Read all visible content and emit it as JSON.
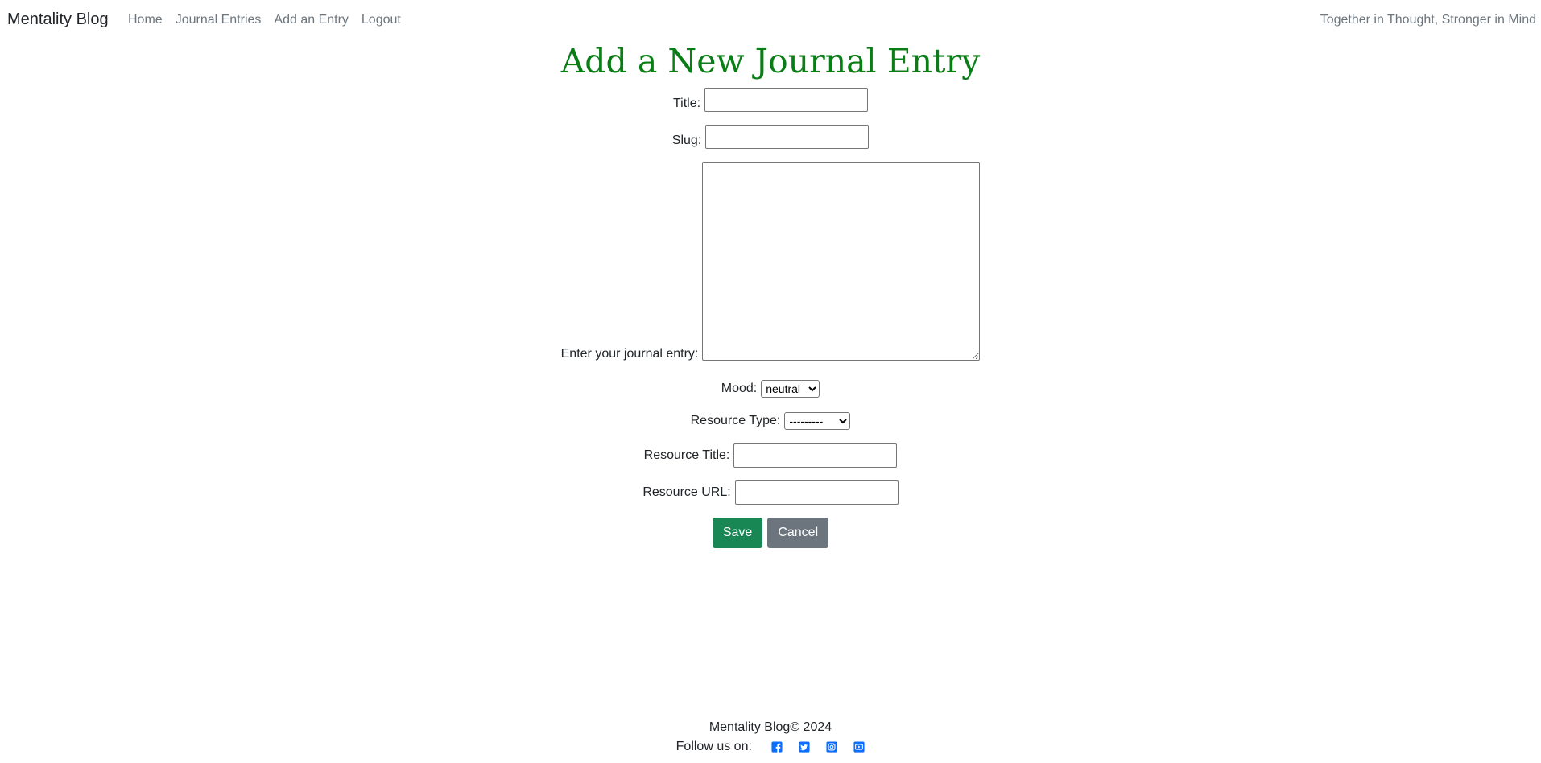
{
  "navbar": {
    "brand": "Mentality Blog",
    "links": [
      "Home",
      "Journal Entries",
      "Add an Entry",
      "Logout"
    ],
    "tagline": "Together in Thought, Stronger in Mind"
  },
  "form": {
    "heading": "Add a New Journal Entry",
    "title_label": "Title:",
    "title_value": "",
    "slug_label": "Slug:",
    "slug_value": "",
    "content_label": "Enter your journal entry:",
    "content_value": "",
    "mood_label": "Mood:",
    "mood_selected": "neutral",
    "resource_type_label": "Resource Type:",
    "resource_type_selected": "---------",
    "resource_title_label": "Resource Title:",
    "resource_title_value": "",
    "resource_url_label": "Resource URL:",
    "resource_url_value": "",
    "save_label": "Save",
    "cancel_label": "Cancel"
  },
  "footer": {
    "copyright": "Mentality Blog© 2024",
    "follow_label": "Follow us on:",
    "social_icons": [
      "facebook-icon",
      "twitter-icon",
      "instagram-icon",
      "youtube-icon"
    ]
  },
  "colors": {
    "heading": "#0a7e16",
    "save_button": "#198754",
    "cancel_button": "#6c757d",
    "nav_link": "#6c757d",
    "social_icon": "#0d6efd"
  }
}
